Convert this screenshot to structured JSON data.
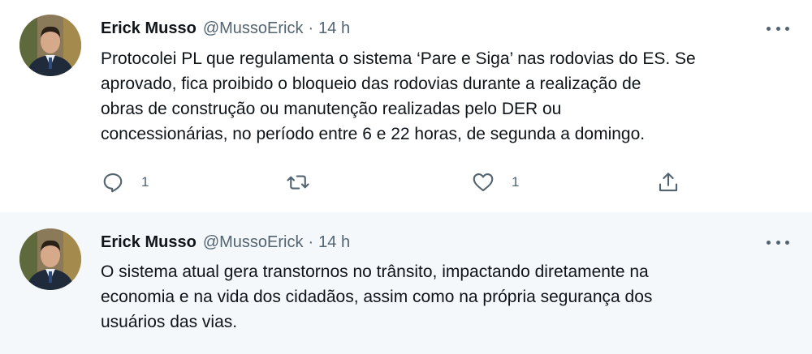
{
  "colors": {
    "text": "#0f1419",
    "secondary": "#536471",
    "thread_line": "#cfd9de",
    "highlight_bg": "#f5f8fa"
  },
  "tweets": [
    {
      "author_name": "Erick Musso",
      "handle": "@MussoErick",
      "separator": "·",
      "time": "14 h",
      "text_lines": [
        "Protocolei PL que regulamenta o sistema ‘Pare e Siga’ nas rodovias do ES. Se",
        "aprovado, fica proibido o bloqueio das rodovias durante a realização de",
        "obras de construção ou manutenção realizadas pelo DER ou",
        "concessionárias, no período entre 6 e 22 horas, de segunda a domingo."
      ],
      "actions": {
        "reply_icon": "reply-icon",
        "reply_count": "1",
        "retweet_icon": "retweet-icon",
        "like_icon": "heart-icon",
        "like_count": "1",
        "share_icon": "share-icon"
      }
    },
    {
      "author_name": "Erick Musso",
      "handle": "@MussoErick",
      "separator": "·",
      "time": "14 h",
      "text_lines": [
        "O sistema atual gera transtornos no trânsito, impactando diretamente na",
        "economia e na vida dos cidadãos, assim como na própria segurança dos",
        "usuários das vias."
      ]
    }
  ]
}
